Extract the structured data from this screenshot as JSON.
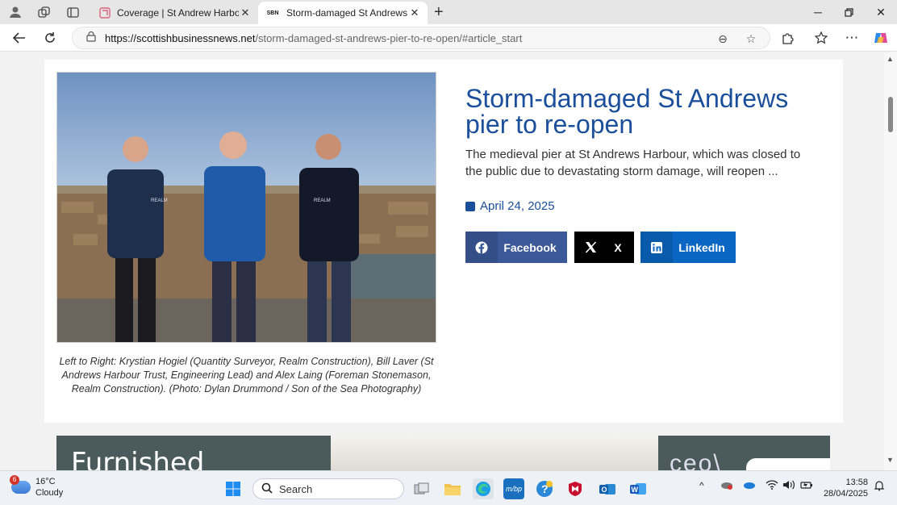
{
  "browser": {
    "tabs": [
      {
        "title": "Coverage | St Andrew Harbour Tr",
        "active": false
      },
      {
        "title": "Storm-damaged St Andrews pier",
        "favicon_text": "SBN",
        "active": true
      }
    ],
    "address": {
      "host": "https://scottishbusinessnews.net",
      "path": "/storm-damaged-st-andrews-pier-to-re-open/#article_start"
    }
  },
  "article": {
    "headline": "Storm-damaged St Andrews pier to re-open",
    "excerpt": "The medieval pier at St Andrews Harbour, which was closed to the public due to devastating storm damage, will reopen ...",
    "date": "April 24, 2025",
    "caption": "Left to Right: Krystian Hogiel (Quantity Surveyor, Realm Construction), Bill Laver (St Andrews Harbour Trust, Engineering Lead) and Alex Laing (Foreman Stonemason, Realm Construction). (Photo: Dylan Drummond / Son of the Sea Photography)",
    "share": {
      "facebook": "Facebook",
      "x": "X",
      "linkedin": "LinkedIn"
    },
    "shirt_logo": "REALM"
  },
  "banner": {
    "left_text": "Furnished",
    "right_text": "ceo\\"
  },
  "taskbar": {
    "weather_badge": "6",
    "temperature": "16°C",
    "condition": "Cloudy",
    "search_placeholder": "Search",
    "time": "13:58",
    "date": "28/04/2025"
  },
  "colors": {
    "accent": "#1b4e9b",
    "facebook": "#3b5998",
    "linkedin": "#0a66c2"
  }
}
